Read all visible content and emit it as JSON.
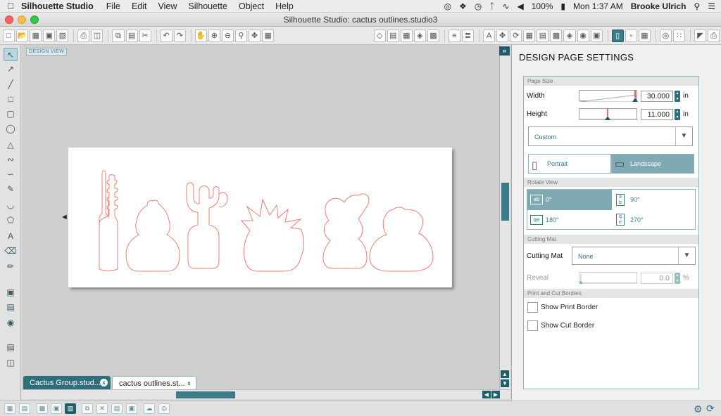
{
  "menubar": {
    "app_name": "Silhouette Studio",
    "menus": [
      "File",
      "Edit",
      "View",
      "Silhouette",
      "Object",
      "Help"
    ],
    "battery": "100%",
    "clock": "Mon 1:37 AM",
    "user": "Brooke Ulrich"
  },
  "window": {
    "title": "Silhouette Studio: cactus outlines.studio3"
  },
  "canvas": {
    "view_label": "DESIGN VIEW",
    "line_color": "#f07d74"
  },
  "tabs": [
    {
      "label": "Cactus Group.stud...",
      "close": "x",
      "active": false
    },
    {
      "label": "cactus outlines.st...",
      "close": "x",
      "active": true
    }
  ],
  "panel": {
    "title": "DESIGN PAGE SETTINGS",
    "page_size": {
      "section": "Page Size",
      "width_label": "Width",
      "width_value": "30.000",
      "height_label": "Height",
      "height_value": "11.000",
      "unit": "in",
      "preset": "Custom"
    },
    "orientation": {
      "portrait": "Portrait",
      "landscape": "Landscape",
      "selected": "landscape"
    },
    "rotate": {
      "section": "Rotate View",
      "options": [
        "0°",
        "90°",
        "180°",
        "270°"
      ],
      "selected": "0°"
    },
    "cutting_mat": {
      "section": "Cutting Mat",
      "label": "Cutting Mat",
      "value": "None",
      "reveal_label": "Reveal",
      "reveal_value": "0.0",
      "reveal_unit": "%"
    },
    "borders": {
      "section": "Print and Cut Borders",
      "show_print": "Show Print Border",
      "show_cut": "Show Cut Border"
    }
  },
  "colors": {
    "accent": "#3b7a86",
    "accent_dark": "#1f5e69",
    "selected_fill": "#7fa9b3"
  }
}
